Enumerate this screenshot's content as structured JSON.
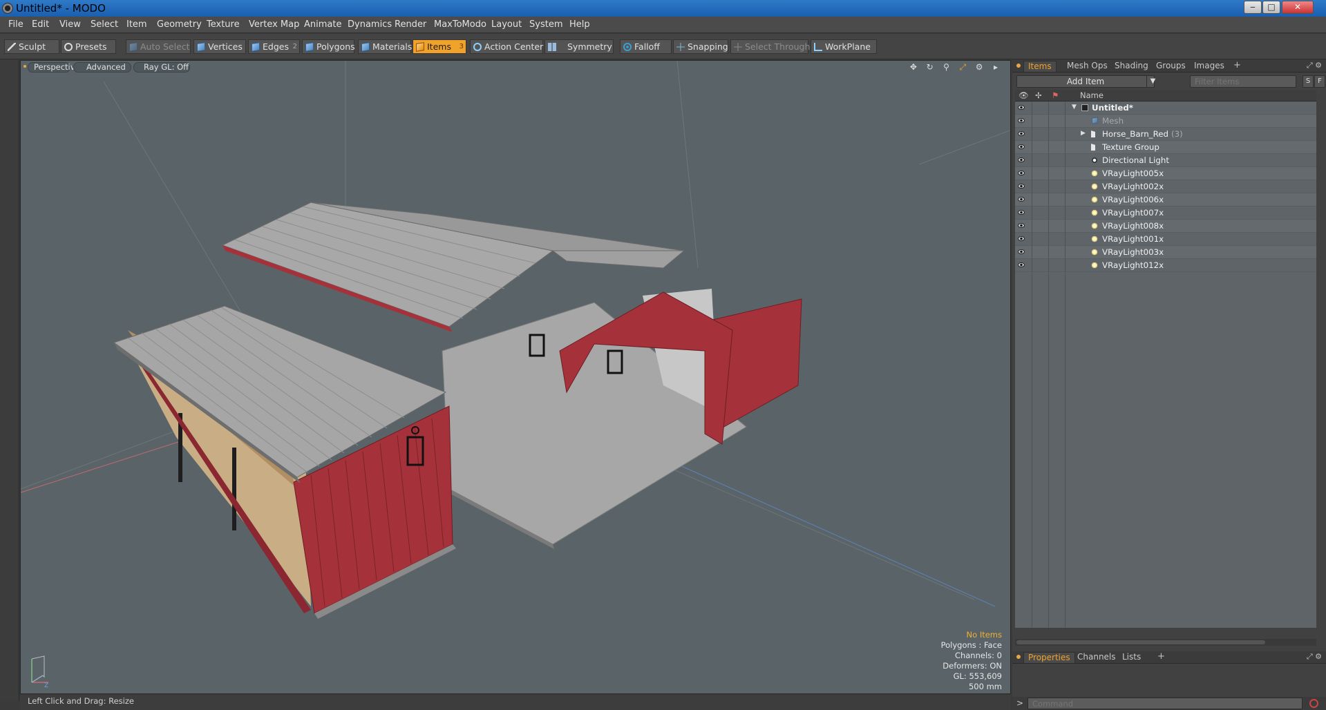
{
  "window": {
    "title": "Untitled* - MODO",
    "minimize": "‒",
    "maximize": "□",
    "close": "✕"
  },
  "menu": [
    "File",
    "Edit",
    "View",
    "Select",
    "Item",
    "Geometry",
    "Texture",
    "Vertex Map",
    "Animate",
    "Dynamics",
    "Render",
    "MaxToModo",
    "Layout",
    "System",
    "Help"
  ],
  "toolbar": {
    "sculpt": "Sculpt",
    "presets": "Presets",
    "auto_select": "Auto Select",
    "vertices": "Vertices",
    "edges": "Edges",
    "edges_count": "2",
    "polygons": "Polygons",
    "materials": "Materials",
    "items": "Items",
    "items_count": "3",
    "action_center": "Action Center",
    "symmetry": "Symmetry",
    "falloff": "Falloff",
    "snapping": "Snapping",
    "select_through": "Select Through",
    "workplane": "WorkPlane"
  },
  "viewport": {
    "tabs": [
      "Perspective",
      "Advanced",
      "Ray GL: Off"
    ],
    "stats": {
      "selection": "No Items",
      "polygons": "Polygons : Face",
      "channels": "Channels: 0",
      "deformers": "Deformers: ON",
      "gl": "GL: 553,609",
      "grid": "500 mm"
    },
    "colors": {
      "background": "#5a6468",
      "barn_red": "#a5323a",
      "roof": "#a6a6a6",
      "concrete": "#a7a7a7",
      "floor": "#c9ad84"
    }
  },
  "status": {
    "text": "Left Click and Drag:  Resize"
  },
  "right_panel": {
    "tabs": [
      "Items",
      "Mesh Ops",
      "Shading",
      "Groups",
      "Images"
    ],
    "tab_plus": "+",
    "add_item": "Add Item",
    "filter_placeholder": "Filter Items",
    "s_btn": "S",
    "f_btn": "F",
    "name_header": "Name",
    "items": [
      {
        "label": "Untitled*",
        "count": ""
      },
      {
        "label": "Mesh",
        "count": ""
      },
      {
        "label": "Horse_Barn_Red",
        "count": "(3)"
      },
      {
        "label": "Texture Group",
        "count": ""
      },
      {
        "label": "Directional Light",
        "count": ""
      },
      {
        "label": "VRayLight005x",
        "count": ""
      },
      {
        "label": "VRayLight002x",
        "count": ""
      },
      {
        "label": "VRayLight006x",
        "count": ""
      },
      {
        "label": "VRayLight007x",
        "count": ""
      },
      {
        "label": "VRayLight008x",
        "count": ""
      },
      {
        "label": "VRayLight001x",
        "count": ""
      },
      {
        "label": "VRayLight003x",
        "count": ""
      },
      {
        "label": "VRayLight012x",
        "count": ""
      }
    ],
    "bottom_tabs": [
      "Properties",
      "Channels",
      "Lists"
    ],
    "command_prompt": ">",
    "command_placeholder": "Command",
    "accent": "#f0a22a"
  }
}
